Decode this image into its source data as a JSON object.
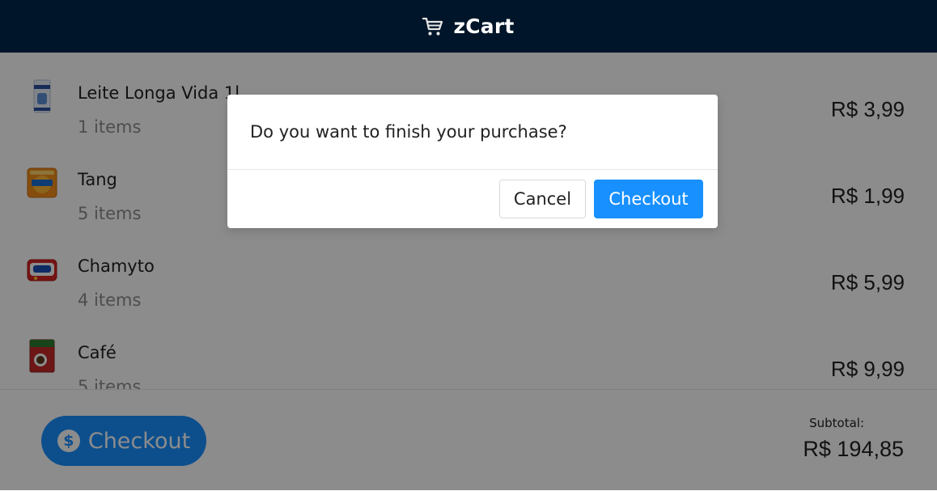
{
  "header": {
    "title": "zCart",
    "icon": "shopping-cart-icon",
    "background": "#001529"
  },
  "cart": {
    "items": [
      {
        "name": "Leite Longa Vida 1l",
        "quantity": "1 items",
        "price": "R$ 3,99",
        "thumbnail": "milk-carton"
      },
      {
        "name": "Tang",
        "quantity": "5 items",
        "price": "R$ 1,99",
        "thumbnail": "tang-sachet"
      },
      {
        "name": "Chamyto",
        "quantity": "4 items",
        "price": "R$ 5,99",
        "thumbnail": "chamyto-pack"
      },
      {
        "name": "Café",
        "quantity": "5 items",
        "price": "R$ 9,99",
        "thumbnail": "coffee-pack"
      }
    ]
  },
  "footer": {
    "checkout_label": "Checkout",
    "checkout_icon": "dollar-icon",
    "subtotal_label": "Subtotal:",
    "subtotal_value": "R$ 194,85"
  },
  "modal": {
    "question": "Do you want to finish your purchase?",
    "cancel_label": "Cancel",
    "confirm_label": "Checkout"
  },
  "colors": {
    "primary": "#1890ff",
    "overlay": "rgba(0,0,0,0.45)"
  }
}
